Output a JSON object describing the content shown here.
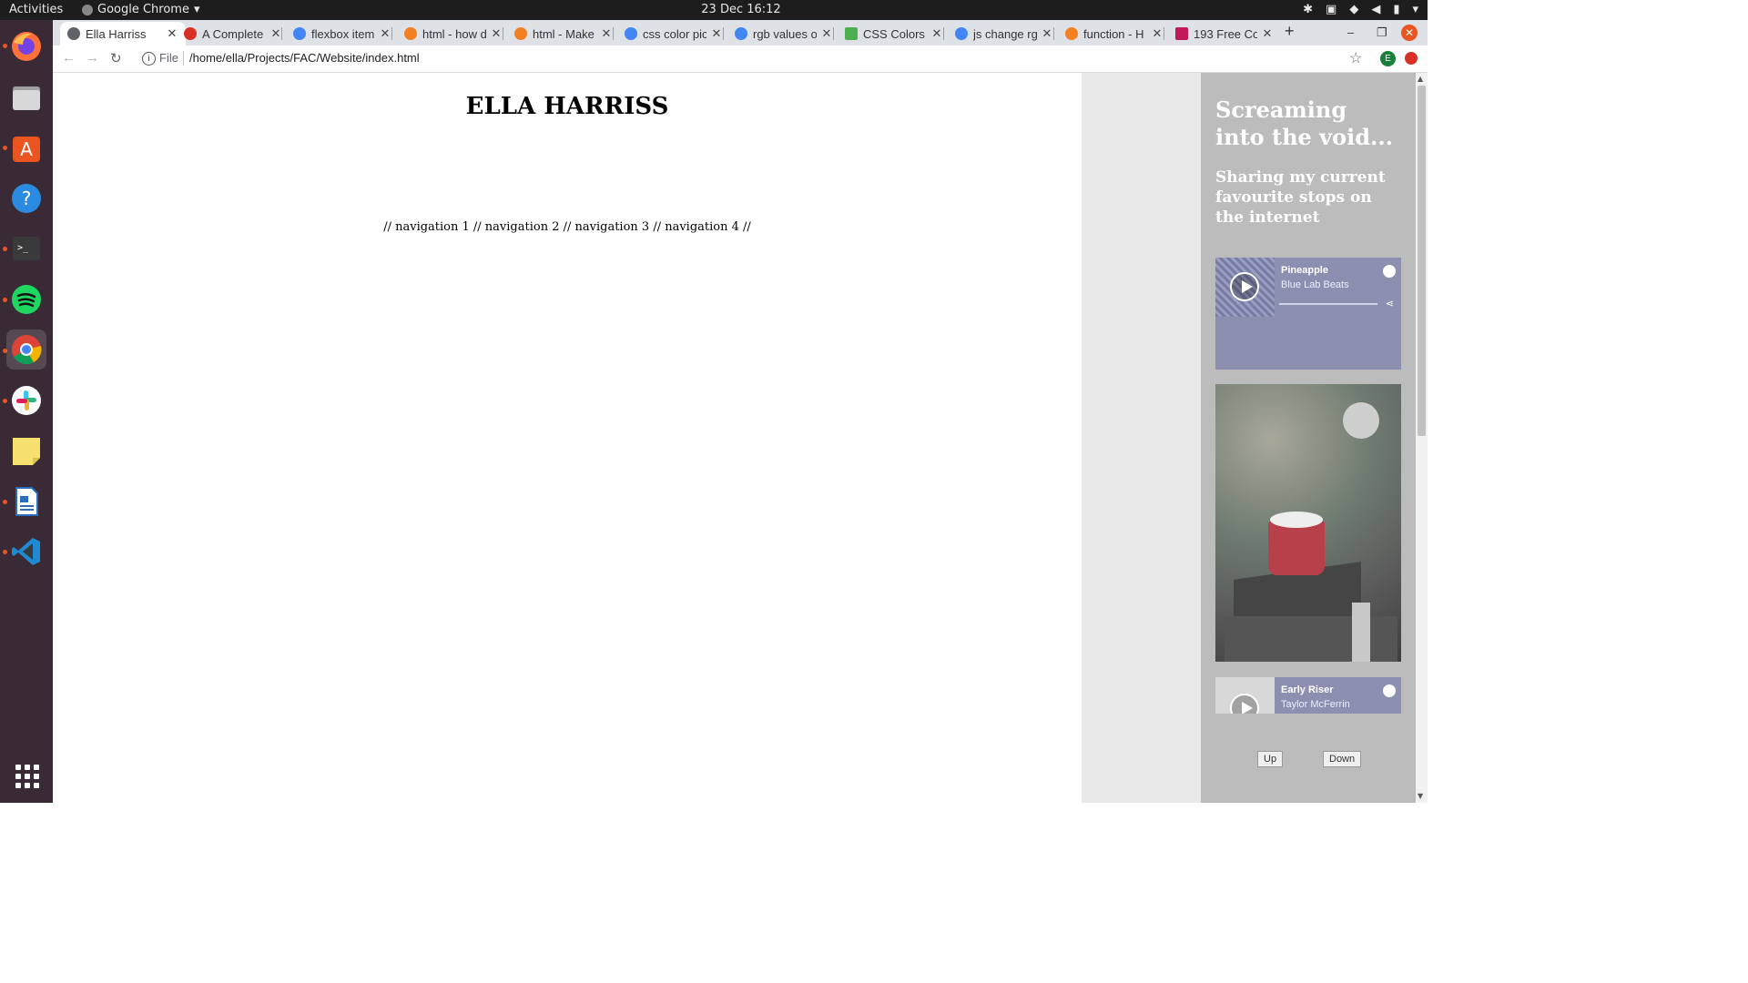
{
  "system": {
    "activities": "Activities",
    "app_name": "Google Chrome",
    "clock": "23 Dec  16:12"
  },
  "browser": {
    "tabs": [
      {
        "label": "Ella Harriss",
        "active": true,
        "favicon_color": "#5f6368"
      },
      {
        "label": "A Complete",
        "favicon_color": "#d93025"
      },
      {
        "label": "flexbox item",
        "favicon_color": "#4285f4"
      },
      {
        "label": "html - how d",
        "favicon_color": "#f48024"
      },
      {
        "label": "html - Make",
        "favicon_color": "#f48024"
      },
      {
        "label": "css color pic",
        "favicon_color": "#4285f4"
      },
      {
        "label": "rgb values o",
        "favicon_color": "#4285f4"
      },
      {
        "label": "CSS Colors",
        "favicon_color": "#4caf50"
      },
      {
        "label": "js change rg",
        "favicon_color": "#4285f4"
      },
      {
        "label": "function - H",
        "favicon_color": "#f48024"
      },
      {
        "label": "193 Free Co",
        "favicon_color": "#c2185b"
      }
    ],
    "new_tab": "+",
    "address": {
      "scheme_label": "File",
      "path": "/home/ella/Projects/FAC/Website/index.html"
    },
    "profile_initial": "E"
  },
  "page": {
    "title": "ELLA HARRISS",
    "nav": "// navigation 1 // navigation 2 // navigation 3 // navigation 4 //",
    "sidebar": {
      "heading": "Screaming into the void...",
      "subheading": "Sharing my current favourite stops on the internet",
      "tracks": [
        {
          "title": "Pineapple",
          "artist": "Blue Lab Beats"
        },
        {
          "title": "Early Riser",
          "artist": "Taylor McFerrin"
        }
      ],
      "up_label": "Up",
      "down_label": "Down"
    }
  },
  "colors": {
    "dock_bg": "#3a2a35",
    "tabstrip_bg": "#dee1e6",
    "sidebar_bg": "#bcbcbc",
    "gutter_bg": "#e8e8e8",
    "player_bg": "#8d8fb0",
    "accent": "#e95420"
  },
  "icons": {
    "dock": [
      "firefox-icon",
      "files-icon",
      "software-icon",
      "help-icon",
      "terminal-icon",
      "spotify-icon",
      "chrome-icon",
      "slack-icon",
      "notes-icon",
      "writer-icon",
      "vscode-icon",
      "app-grid-icon"
    ]
  }
}
